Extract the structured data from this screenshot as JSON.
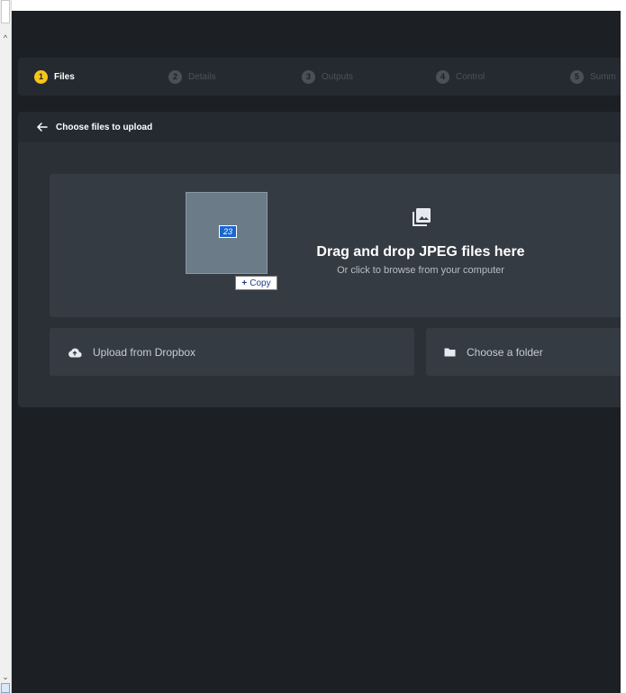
{
  "stepper": {
    "steps": [
      {
        "number": "1",
        "label": "Files",
        "active": true
      },
      {
        "number": "2",
        "label": "Details",
        "active": false
      },
      {
        "number": "3",
        "label": "Outputs",
        "active": false
      },
      {
        "number": "4",
        "label": "Control",
        "active": false
      },
      {
        "number": "5",
        "label": "Summ",
        "active": false
      }
    ]
  },
  "panel": {
    "title": "Choose files to upload",
    "back_icon": "arrow-left-icon"
  },
  "dropzone": {
    "icon": "photo-library-icon",
    "title": "Drag and drop JPEG files here",
    "subtitle": "Or click to browse from your computer"
  },
  "sources": {
    "dropbox": {
      "icon": "cloud-upload-icon",
      "label": "Upload from Dropbox"
    },
    "folder": {
      "icon": "folder-icon",
      "label": "Choose a folder"
    }
  },
  "drag": {
    "count": "23",
    "copy_label": "Copy",
    "plus": "+"
  },
  "colors": {
    "background": "#1c1f24",
    "panel": "#2b3037",
    "card": "#353b43",
    "active_step": "#f5c518"
  }
}
